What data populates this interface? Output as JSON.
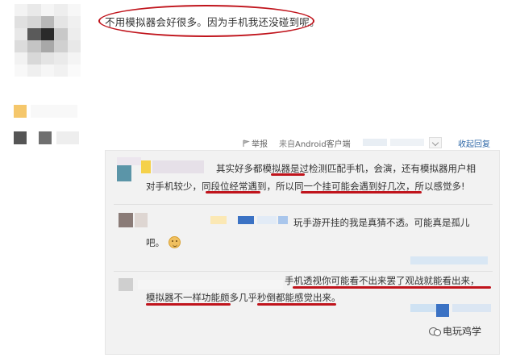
{
  "post": {
    "text": "不用模拟器会好很多。因为手机我还没碰到呢。"
  },
  "actions": {
    "report_label": "举报",
    "source_prefix": "来自",
    "source_client": "Android客户端",
    "collapse_reply_label": "收起回复"
  },
  "replies": [
    {
      "lines": [
        "其实好多都模拟器是过检测匹配手机，会演，还有模拟器用户相",
        "对手机较少，同段位经常遇到，所以同一个挂可能会遇到好几次，所以感觉多!"
      ]
    },
    {
      "lines": [
        "玩手游开挂的我是真猜不透。可能真是孤儿",
        "吧。"
      ]
    },
    {
      "lines": [
        "手机透视你可能看不出来罢了观战就能看出来，",
        "模拟器不一样功能颇多几乎秒倒都能感觉出来。"
      ]
    }
  ],
  "watermark": {
    "text": "电玩鸡学"
  },
  "colors": {
    "annotation_red": "#c0141c",
    "link_blue": "#3069a8",
    "reply_bg": "#f2f2f2"
  }
}
